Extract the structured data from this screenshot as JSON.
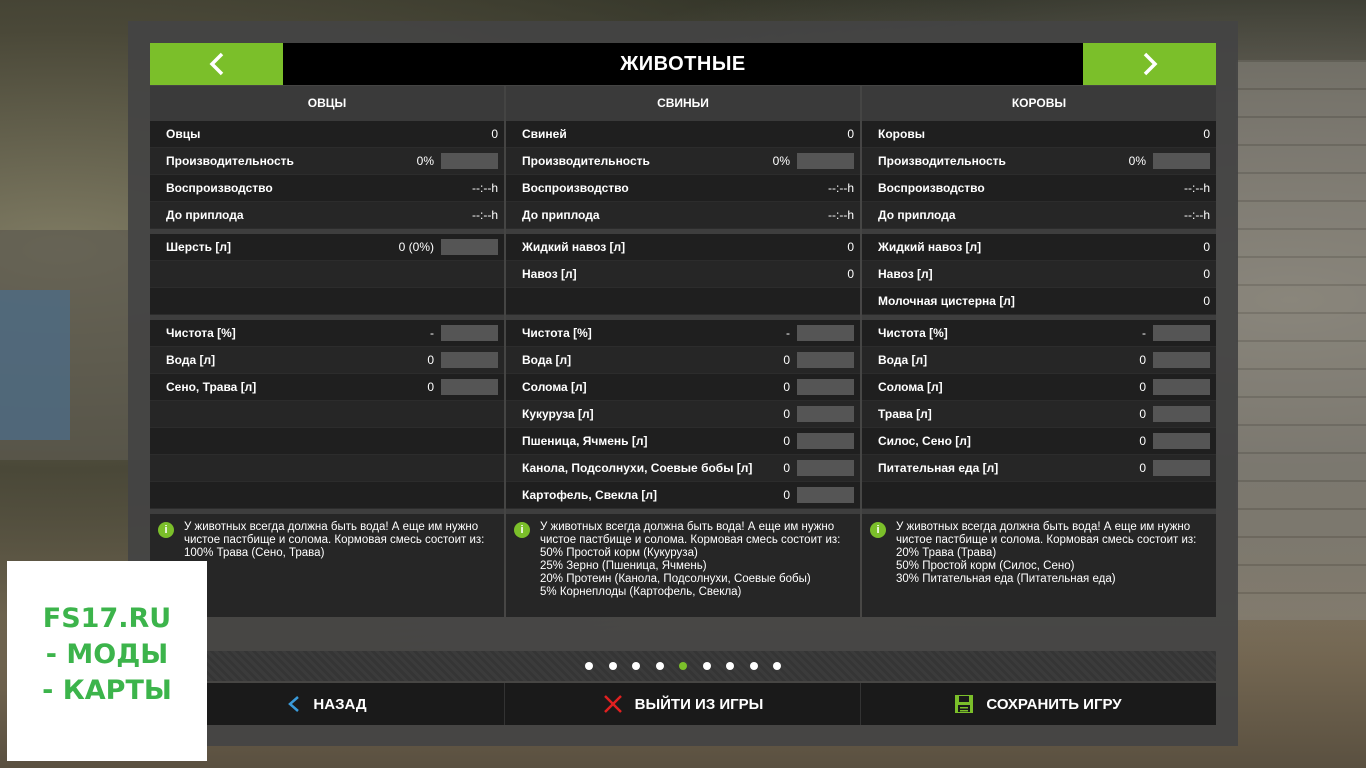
{
  "header": {
    "title": "ЖИВОТНЫЕ"
  },
  "columns": [
    {
      "title": "ОВЦЫ",
      "rows": [
        {
          "label": "Овцы",
          "value": "0",
          "bar": false
        },
        {
          "label": "Производительность",
          "value": "0%",
          "bar": true
        },
        {
          "label": "Воспроизводство",
          "value": "--:--h",
          "bar": false
        },
        {
          "label": "До приплода",
          "value": "--:--h",
          "bar": false
        }
      ],
      "products": [
        {
          "label": "Шерсть [л]",
          "value": "0 (0%)",
          "bar": true
        },
        {
          "label": "",
          "value": "",
          "bar": false
        },
        {
          "label": "",
          "value": "",
          "bar": false
        }
      ],
      "feed": [
        {
          "label": "Чистота [%]",
          "value": "-",
          "bar": true
        },
        {
          "label": "Вода [л]",
          "value": "0",
          "bar": true
        },
        {
          "label": "Сено, Трава [л]",
          "value": "0",
          "bar": true
        },
        {
          "label": "",
          "value": "",
          "bar": false
        },
        {
          "label": "",
          "value": "",
          "bar": false
        },
        {
          "label": "",
          "value": "",
          "bar": false
        },
        {
          "label": "",
          "value": "",
          "bar": false
        }
      ],
      "info": [
        "У животных всегда должна быть вода! А еще им нужно чистое пастбище и солома. Кормовая смесь состоит из:",
        "100% Трава (Сено, Трава)"
      ]
    },
    {
      "title": "СВИНЬИ",
      "rows": [
        {
          "label": "Свиней",
          "value": "0",
          "bar": false
        },
        {
          "label": "Производительность",
          "value": "0%",
          "bar": true
        },
        {
          "label": "Воспроизводство",
          "value": "--:--h",
          "bar": false
        },
        {
          "label": "До приплода",
          "value": "--:--h",
          "bar": false
        }
      ],
      "products": [
        {
          "label": "Жидкий навоз [л]",
          "value": "0",
          "bar": false
        },
        {
          "label": "Навоз [л]",
          "value": "0",
          "bar": false
        },
        {
          "label": "",
          "value": "",
          "bar": false
        }
      ],
      "feed": [
        {
          "label": "Чистота [%]",
          "value": "-",
          "bar": true
        },
        {
          "label": "Вода [л]",
          "value": "0",
          "bar": true
        },
        {
          "label": "Солома [л]",
          "value": "0",
          "bar": true
        },
        {
          "label": "Кукуруза [л]",
          "value": "0",
          "bar": true
        },
        {
          "label": "Пшеница, Ячмень [л]",
          "value": "0",
          "bar": true
        },
        {
          "label": "Канола, Подсолнухи, Соевые бобы [л]",
          "value": "0",
          "bar": true
        },
        {
          "label": "Картофель, Свекла [л]",
          "value": "0",
          "bar": true
        }
      ],
      "info": [
        "У животных всегда должна быть вода! А еще им нужно чистое пастбище и солома. Кормовая смесь состоит из:",
        "50% Простой корм (Кукуруза)",
        "25% Зерно (Пшеница, Ячмень)",
        "20% Протеин (Канола, Подсолнухи, Соевые бобы)",
        "5% Корнеплоды (Картофель, Свекла)"
      ]
    },
    {
      "title": "КОРОВЫ",
      "rows": [
        {
          "label": "Коровы",
          "value": "0",
          "bar": false
        },
        {
          "label": "Производительность",
          "value": "0%",
          "bar": true
        },
        {
          "label": "Воспроизводство",
          "value": "--:--h",
          "bar": false
        },
        {
          "label": "До приплода",
          "value": "--:--h",
          "bar": false
        }
      ],
      "products": [
        {
          "label": "Жидкий навоз [л]",
          "value": "0",
          "bar": false
        },
        {
          "label": "Навоз [л]",
          "value": "0",
          "bar": false
        },
        {
          "label": "Молочная цистерна [л]",
          "value": "0",
          "bar": false
        }
      ],
      "feed": [
        {
          "label": "Чистота [%]",
          "value": "-",
          "bar": true
        },
        {
          "label": "Вода [л]",
          "value": "0",
          "bar": true
        },
        {
          "label": "Солома [л]",
          "value": "0",
          "bar": true
        },
        {
          "label": "Трава [л]",
          "value": "0",
          "bar": true
        },
        {
          "label": "Силос, Сено [л]",
          "value": "0",
          "bar": true
        },
        {
          "label": "Питательная еда [л]",
          "value": "0",
          "bar": true
        },
        {
          "label": "",
          "value": "",
          "bar": false
        }
      ],
      "info": [
        "У животных всегда должна быть вода! А еще им нужно чистое пастбище и солома. Кормовая смесь состоит из:",
        "20% Трава (Трава)",
        "50% Простой корм (Силос, Сено)",
        "30% Питательная еда (Питательная еда)"
      ]
    }
  ],
  "pagination": {
    "count": 9,
    "active_index": 4
  },
  "footer": {
    "back_label": "НАЗАД",
    "quit_label": "ВЫЙТИ ИЗ ИГРЫ",
    "save_label": "СОХРАНИТЬ ИГРУ"
  },
  "watermark": {
    "line1": "FS17.RU",
    "line2": "- МОДЫ",
    "line3": "- КАРТЫ"
  },
  "colors": {
    "accent": "#7bbf2a",
    "quit_icon": "#e02020",
    "back_icon": "#3a9ad9",
    "watermark": "#3cb44b"
  },
  "icons": {
    "prev": "chevron-left-icon",
    "next": "chevron-right-icon",
    "info": "info-icon",
    "back": "chevron-left-icon",
    "quit": "close-x-icon",
    "save": "floppy-disk-icon"
  }
}
